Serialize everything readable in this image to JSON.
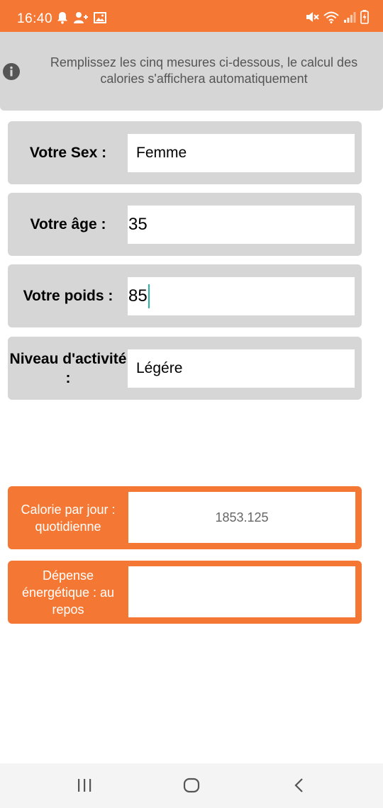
{
  "status_bar": {
    "time": "16:40",
    "left_icons": [
      "bell-icon",
      "person-add-icon",
      "image-icon"
    ],
    "right_icons": [
      "mute-icon",
      "wifi-icon",
      "signal-icon",
      "battery-charging-icon"
    ]
  },
  "info": {
    "text": "Remplissez les cinq mesures ci-dessous, le calcul des calories s'affichera automatiquement",
    "icon": "info-icon"
  },
  "form": {
    "sex": {
      "label": "Votre Sex :",
      "value": "Femme"
    },
    "age": {
      "label": "Votre âge :",
      "value": "35"
    },
    "weight": {
      "label": "Votre poids :",
      "value": "85"
    },
    "activity": {
      "label": "Niveau d'activité :",
      "value": "Légére"
    }
  },
  "results": {
    "daily": {
      "label": "Calorie par jour : quotidienne",
      "value": "1853.125"
    },
    "resting": {
      "label": "Dépense énergétique : au repos",
      "value": ""
    }
  },
  "colors": {
    "accent": "#f47834",
    "card": "#d6d6d6",
    "cursor": "#26b5a4"
  }
}
